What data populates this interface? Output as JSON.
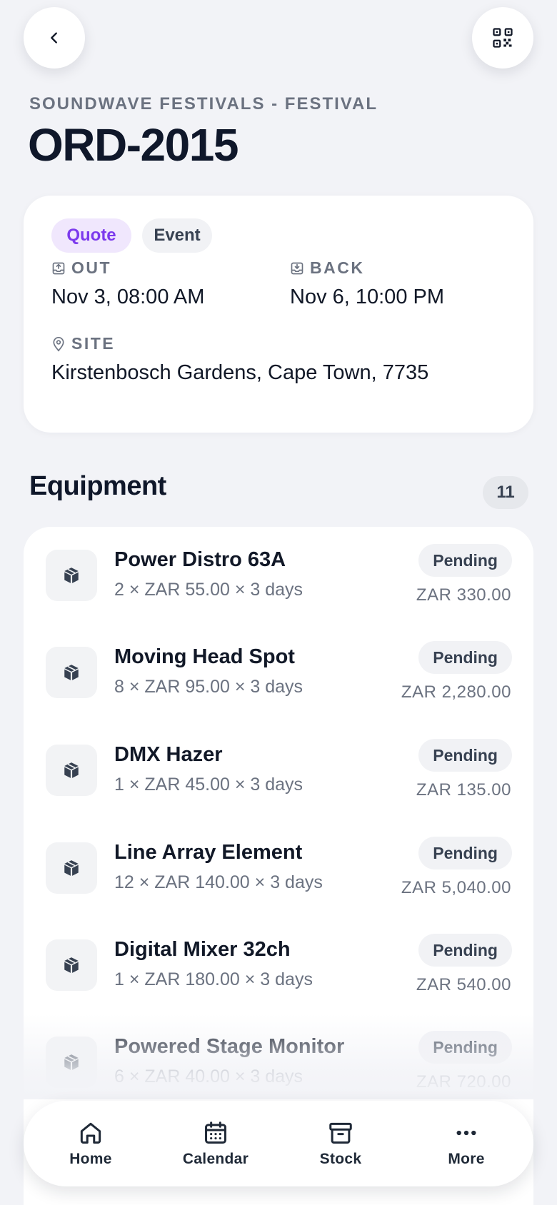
{
  "header": {
    "subtitle": "SOUNDWAVE FESTIVALS - FESTIVAL",
    "order_id": "ORD-2015"
  },
  "icons": {
    "back": "chevron-left-icon",
    "qr": "qr-code-icon",
    "out": "upload-tray-icon",
    "back_date": "download-tray-icon",
    "site": "map-pin-icon",
    "item": "package-icon"
  },
  "colors": {
    "accent": "#7c3aed",
    "quote_chip_bg": "#f0e7fd",
    "background": "#f2f3f7"
  },
  "info": {
    "chips": [
      "Quote",
      "Event"
    ],
    "out": {
      "label": "OUT",
      "value": "Nov 3, 08:00 AM"
    },
    "back": {
      "label": "BACK",
      "value": "Nov 6, 10:00 PM"
    },
    "site": {
      "label": "SITE",
      "value": "Kirstenbosch Gardens, Cape Town, 7735"
    }
  },
  "equipment": {
    "title": "Equipment",
    "count": "11",
    "items": [
      {
        "name": "Power Distro 63A",
        "detail": "2 × ZAR 55.00 × 3 days",
        "status": "Pending",
        "total": "ZAR 330.00"
      },
      {
        "name": "Moving Head Spot",
        "detail": "8 × ZAR 95.00 × 3 days",
        "status": "Pending",
        "total": "ZAR 2,280.00"
      },
      {
        "name": "DMX Hazer",
        "detail": "1 × ZAR 45.00 × 3 days",
        "status": "Pending",
        "total": "ZAR 135.00"
      },
      {
        "name": "Line Array Element",
        "detail": "12 × ZAR 140.00 × 3 days",
        "status": "Pending",
        "total": "ZAR 5,040.00"
      },
      {
        "name": "Digital Mixer 32ch",
        "detail": "1 × ZAR 180.00 × 3 days",
        "status": "Pending",
        "total": "ZAR 540.00"
      },
      {
        "name": "Powered Stage Monitor",
        "detail": "6 × ZAR 40.00 × 3 days",
        "status": "Pending",
        "total": "ZAR 720.00"
      }
    ]
  },
  "nav": {
    "home": "Home",
    "calendar": "Calendar",
    "stock": "Stock",
    "more": "More"
  }
}
